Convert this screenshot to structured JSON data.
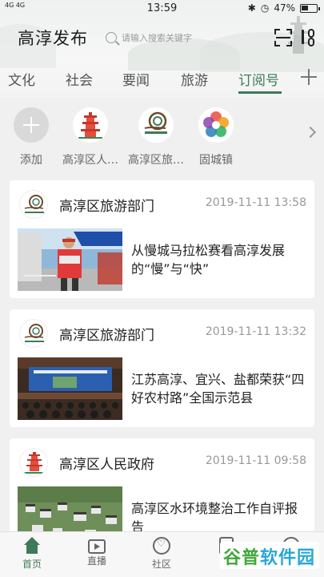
{
  "status_bar": {
    "signal": "4G 4G",
    "time": "13:59",
    "battery": "47%",
    "icons": [
      "bluetooth-icon",
      "alarm-icon"
    ]
  },
  "app": {
    "title": "高淳发布"
  },
  "search": {
    "placeholder": "请输入搜索关键字"
  },
  "tabs": [
    {
      "label": "文化"
    },
    {
      "label": "社会"
    },
    {
      "label": "要闻"
    },
    {
      "label": "旅游"
    },
    {
      "label": "订阅号",
      "active": true
    }
  ],
  "subscriptions": [
    {
      "label": "添加",
      "icon": "plus-icon"
    },
    {
      "label": "高淳区人…",
      "icon": "pagoda-logo"
    },
    {
      "label": "高淳区旅…",
      "icon": "snail-logo"
    },
    {
      "label": "固城镇",
      "icon": "rainbow-flower-logo"
    }
  ],
  "feed": [
    {
      "source": "高淳区旅游部门",
      "time": "2019-11-11 13:58",
      "headline": "从慢城马拉松赛看高淳发展的“慢”与“快”",
      "logo": "snail-logo",
      "thumb": "marathon-photo"
    },
    {
      "source": "高淳区旅游部门",
      "time": "2019-11-11 13:32",
      "headline": "江苏高淳、宜兴、盐都荣获“四好农村路”全国示范县",
      "logo": "snail-logo",
      "thumb": "conference-photo"
    },
    {
      "source": "高淳区人民政府",
      "time": "2019-11-11 09:58",
      "headline": "高淳区水环境整治工作自评报告",
      "logo": "pagoda-logo",
      "thumb": "village-aerial-photo"
    }
  ],
  "bottom_nav": [
    {
      "label": "首页",
      "active": true,
      "icon": "home-icon"
    },
    {
      "label": "直播",
      "icon": "tv-icon"
    },
    {
      "label": "社区",
      "icon": "community-icon"
    },
    {
      "label": "",
      "icon": "document-icon"
    },
    {
      "label": "",
      "icon": "user-icon"
    }
  ],
  "watermark": {
    "text_1": "谷普",
    "text_2": "软件园"
  },
  "colors": {
    "accent": "#3e7a5a",
    "background": "#f0f0f0",
    "card": "#ffffff",
    "muted_text": "#999999"
  }
}
